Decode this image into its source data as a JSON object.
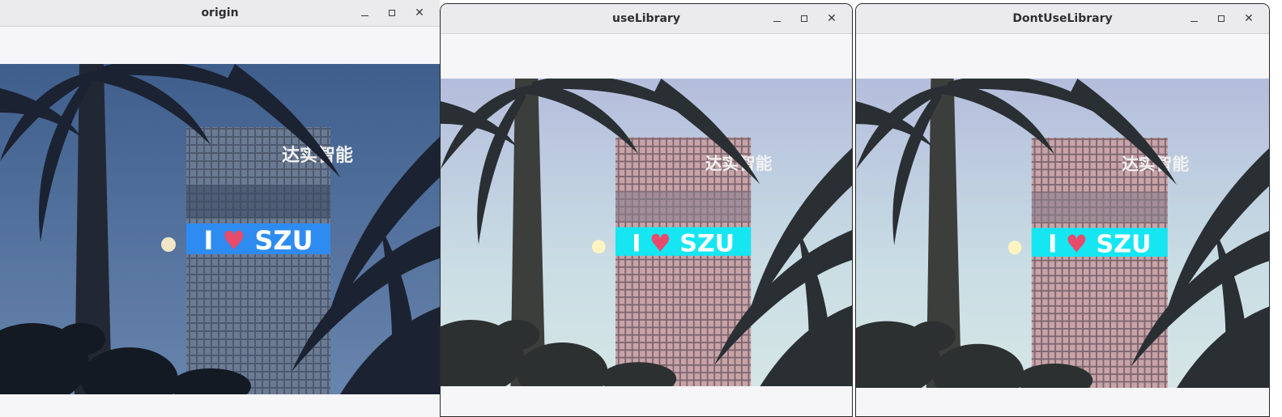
{
  "windows": [
    {
      "title": "origin",
      "image": {
        "sign_text": "I ♥ SZU",
        "building_text": "达实智能"
      }
    },
    {
      "title": "useLibrary",
      "image": {
        "sign_text": "I ♥ SZU",
        "building_text": "达实智能"
      }
    },
    {
      "title": "DontUseLibrary",
      "image": {
        "sign_text": "I ♥ SZU",
        "building_text": "达实智能"
      }
    }
  ],
  "controls": {
    "minimize_icon": "minimize-icon",
    "maximize_icon": "maximize-icon",
    "close_icon": "close-icon"
  }
}
